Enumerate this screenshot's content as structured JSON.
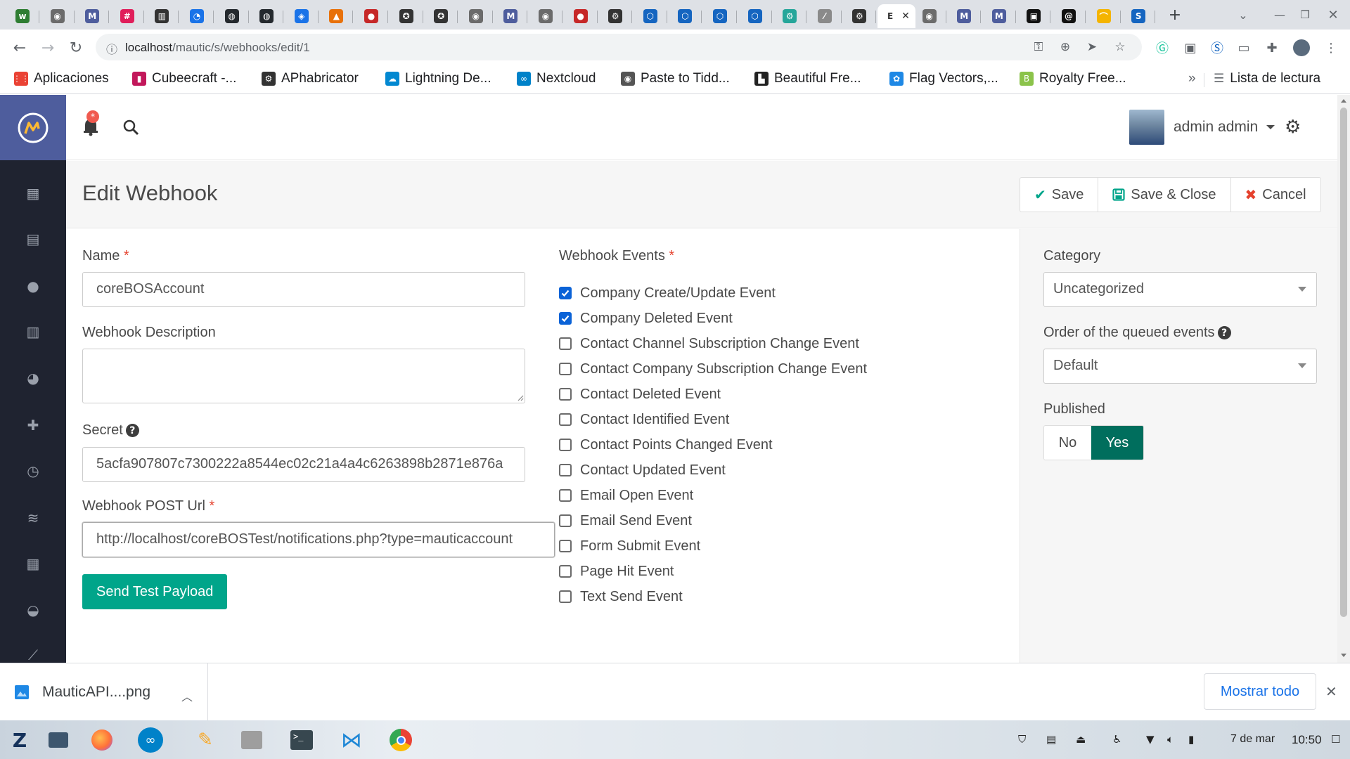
{
  "browser": {
    "tabs": [
      {
        "icon": "w",
        "color": "#2e7d32"
      },
      {
        "icon": "◉",
        "color": "#6b6b6b"
      },
      {
        "icon": "M",
        "color": "#4e5d9d"
      },
      {
        "icon": "#",
        "color": "#e01e5a"
      },
      {
        "icon": "▥",
        "color": "#333333"
      },
      {
        "icon": "◔",
        "color": "#1a73e8"
      },
      {
        "icon": "◍",
        "color": "#24292e"
      },
      {
        "icon": "◍",
        "color": "#24292e"
      },
      {
        "icon": "◈",
        "color": "#1a73e8"
      },
      {
        "icon": "▲",
        "color": "#e8710a"
      },
      {
        "icon": "●",
        "color": "#c62828"
      },
      {
        "icon": "✪",
        "color": "#333333"
      },
      {
        "icon": "✪",
        "color": "#333333"
      },
      {
        "icon": "◉",
        "color": "#6b6b6b"
      },
      {
        "icon": "M",
        "color": "#4e5d9d"
      },
      {
        "icon": "◉",
        "color": "#6b6b6b"
      },
      {
        "icon": "●",
        "color": "#c62828"
      },
      {
        "icon": "⚙",
        "color": "#333333"
      },
      {
        "icon": "⬡",
        "color": "#1565c0"
      },
      {
        "icon": "⬡",
        "color": "#1565c0"
      },
      {
        "icon": "⬡",
        "color": "#1565c0"
      },
      {
        "icon": "⬡",
        "color": "#1565c0"
      },
      {
        "icon": "⚙",
        "color": "#26a69a"
      },
      {
        "icon": "⁄",
        "color": "#8a8a8a"
      },
      {
        "icon": "⚙",
        "color": "#333333"
      },
      {
        "icon": "E",
        "color": "#333333"
      },
      {
        "icon": "◉",
        "color": "#6b6b6b"
      },
      {
        "icon": "M",
        "color": "#4e5d9d"
      },
      {
        "icon": "M",
        "color": "#4e5d9d"
      },
      {
        "icon": "▣",
        "color": "#111111"
      },
      {
        "icon": "@",
        "color": "#111111"
      },
      {
        "icon": "⌒",
        "color": "#f4b400"
      },
      {
        "icon": "S",
        "color": "#1565c0"
      }
    ],
    "url_host": "localhost",
    "url_path": "/mautic/s/webhooks/edit/1",
    "bookmarks": [
      {
        "label": "Aplicaciones",
        "icon": "⋮⋮",
        "color": "#ea4335"
      },
      {
        "label": "Cubeecraft -...",
        "icon": "▮",
        "color": "#c2185b"
      },
      {
        "label": "APhabricator",
        "icon": "⚙",
        "color": "#333333"
      },
      {
        "label": "Lightning De...",
        "icon": "☁",
        "color": "#0288d1"
      },
      {
        "label": "Nextcloud",
        "icon": "∞",
        "color": "#0082c9"
      },
      {
        "label": "Paste to Tidd...",
        "icon": "◉",
        "color": "#555555"
      },
      {
        "label": "Beautiful Fre...",
        "icon": "▙",
        "color": "#222222"
      },
      {
        "label": "Flag Vectors,...",
        "icon": "✿",
        "color": "#1e88e5"
      },
      {
        "label": "Royalty Free...",
        "icon": "B",
        "color": "#8bc34a"
      }
    ],
    "bookmarks_more": "»",
    "reading_list": "Lista de lectura"
  },
  "mautic": {
    "user_name": "admin admin",
    "page_title": "Edit Webhook",
    "buttons": {
      "save": "Save",
      "save_close": "Save & Close",
      "cancel": "Cancel",
      "send_test": "Send Test Payload"
    },
    "form": {
      "name_label": "Name",
      "name_value": "coreBOSAccount",
      "description_label": "Webhook Description",
      "description_value": "",
      "secret_label": "Secret",
      "secret_value": "5acfa907807c7300222a8544ec02c21a4a4c6263898b2871e876a",
      "url_label": "Webhook POST Url",
      "url_value": "http://localhost/coreBOSTest/notifications.php?type=mauticaccount"
    },
    "events_label": "Webhook Events",
    "events": [
      {
        "label": "Company Create/Update Event",
        "checked": true
      },
      {
        "label": "Company Deleted Event",
        "checked": true
      },
      {
        "label": "Contact Channel Subscription Change Event",
        "checked": false
      },
      {
        "label": "Contact Company Subscription Change Event",
        "checked": false
      },
      {
        "label": "Contact Deleted Event",
        "checked": false
      },
      {
        "label": "Contact Identified Event",
        "checked": false
      },
      {
        "label": "Contact Points Changed Event",
        "checked": false
      },
      {
        "label": "Contact Updated Event",
        "checked": false
      },
      {
        "label": "Email Open Event",
        "checked": false
      },
      {
        "label": "Email Send Event",
        "checked": false
      },
      {
        "label": "Form Submit Event",
        "checked": false
      },
      {
        "label": "Page Hit Event",
        "checked": false
      },
      {
        "label": "Text Send Event",
        "checked": false
      }
    ],
    "right": {
      "category_label": "Category",
      "category_value": "Uncategorized",
      "order_label": "Order of the queued events",
      "order_value": "Default",
      "published_label": "Published",
      "published_no": "No",
      "published_yes": "Yes"
    },
    "accent_color": "#00a58a",
    "sidebar_color": "#1f2330",
    "logo_bg": "#4e5d9d"
  },
  "downloads": {
    "file_name": "MauticAPI....png",
    "show_all": "Mostrar todo"
  },
  "taskbar": {
    "date": "7 de mar",
    "time": "10:50"
  }
}
